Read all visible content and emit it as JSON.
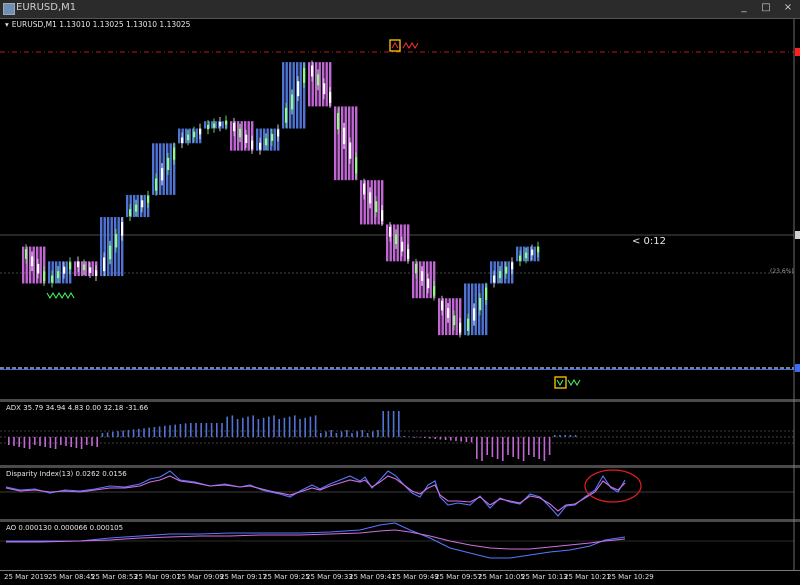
{
  "window": {
    "title": "EURUSD,M1",
    "buttons": [
      "_",
      "□",
      "×"
    ]
  },
  "symbol_info": "EURUSD,M1  1.13010 1.13025 1.13010 1.13025",
  "countdown": "< 0:12",
  "fib_label": "(23.6%)",
  "indicators": {
    "adx": "ADX 35.79 34.94 4.83 0.00 32.18 -31.66",
    "disparity": "Disparity Index(13) 0.0262 0.0156",
    "ao": "AO 0.000130 0.000066 0.000105"
  },
  "time_labels": [
    "25 Mar 2019",
    "25 Mar 08:45",
    "25 Mar 08:53",
    "25 Mar 09:01",
    "25 Mar 09:09",
    "25 Mar 09:17",
    "25 Mar 09:25",
    "25 Mar 09:33",
    "25 Mar 09:41",
    "25 Mar 09:49",
    "25 Mar 09:57",
    "25 Mar 10:05",
    "25 Mar 10:13",
    "25 Mar 10:21",
    "25 Mar 10:29"
  ],
  "colors": {
    "bull_box": "#4f74d4",
    "bear_box": "#c266d6",
    "bull_candle": "#8cff7a",
    "bear_candle": "#ffffff",
    "resistance": "#ff2020",
    "support": "#ffffff",
    "marker": "#ffcc00",
    "annotation": "#e02020"
  },
  "icons": {
    "sell_marker": "sell-signal-icon",
    "buy_marker": "buy-signal-icon"
  },
  "chart_data": {
    "type": "candlestick",
    "boxes": [
      {
        "dir": "bear",
        "o": 1.1298,
        "c": 1.1293
      },
      {
        "dir": "bull",
        "o": 1.1293,
        "c": 1.1296
      },
      {
        "dir": "bear",
        "o": 1.1296,
        "c": 1.1294
      },
      {
        "dir": "bull",
        "o": 1.1294,
        "c": 1.1302
      },
      {
        "dir": "bull",
        "o": 1.1302,
        "c": 1.1305
      },
      {
        "dir": "bull",
        "o": 1.1305,
        "c": 1.1312
      },
      {
        "dir": "bull",
        "o": 1.1312,
        "c": 1.1314
      },
      {
        "dir": "bull",
        "o": 1.1314,
        "c": 1.1315
      },
      {
        "dir": "bear",
        "o": 1.1315,
        "c": 1.1311
      },
      {
        "dir": "bull",
        "o": 1.1311,
        "c": 1.1314
      },
      {
        "dir": "bull",
        "o": 1.1314,
        "c": 1.1323
      },
      {
        "dir": "bear",
        "o": 1.1323,
        "c": 1.1317
      },
      {
        "dir": "bear",
        "o": 1.1317,
        "c": 1.1307
      },
      {
        "dir": "bear",
        "o": 1.1307,
        "c": 1.1301
      },
      {
        "dir": "bear",
        "o": 1.1301,
        "c": 1.1296
      },
      {
        "dir": "bear",
        "o": 1.1296,
        "c": 1.1291
      },
      {
        "dir": "bear",
        "o": 1.1291,
        "c": 1.1286
      },
      {
        "dir": "bull",
        "o": 1.1286,
        "c": 1.1293
      },
      {
        "dir": "bull",
        "o": 1.1293,
        "c": 1.1296
      },
      {
        "dir": "bull",
        "o": 1.1296,
        "c": 1.1298
      }
    ],
    "resistance": 1.1324,
    "current": 1.1298,
    "support": 1.1283
  }
}
